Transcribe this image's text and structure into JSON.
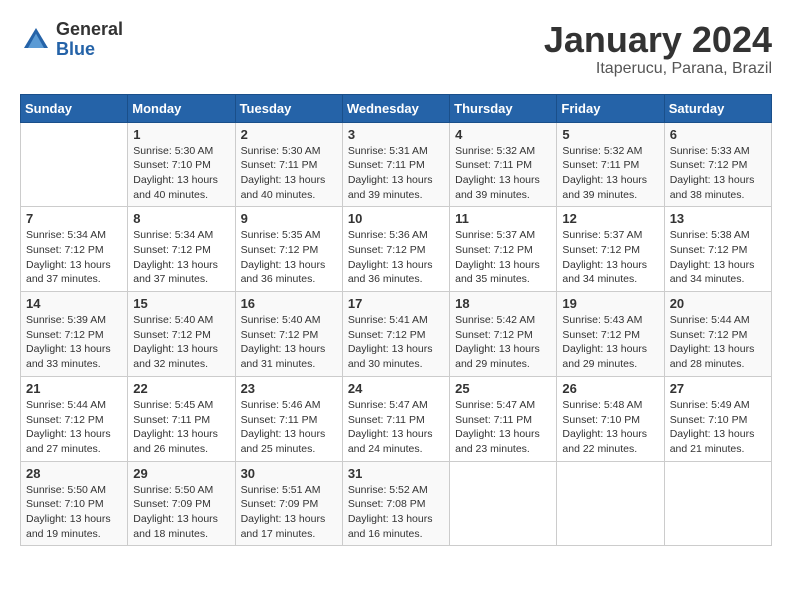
{
  "header": {
    "logo_general": "General",
    "logo_blue": "Blue",
    "month_title": "January 2024",
    "location": "Itaperucu, Parana, Brazil"
  },
  "days_of_week": [
    "Sunday",
    "Monday",
    "Tuesday",
    "Wednesday",
    "Thursday",
    "Friday",
    "Saturday"
  ],
  "weeks": [
    [
      {
        "day": "",
        "sunrise": "",
        "sunset": "",
        "daylight": ""
      },
      {
        "day": "1",
        "sunrise": "Sunrise: 5:30 AM",
        "sunset": "Sunset: 7:10 PM",
        "daylight": "Daylight: 13 hours and 40 minutes."
      },
      {
        "day": "2",
        "sunrise": "Sunrise: 5:30 AM",
        "sunset": "Sunset: 7:11 PM",
        "daylight": "Daylight: 13 hours and 40 minutes."
      },
      {
        "day": "3",
        "sunrise": "Sunrise: 5:31 AM",
        "sunset": "Sunset: 7:11 PM",
        "daylight": "Daylight: 13 hours and 39 minutes."
      },
      {
        "day": "4",
        "sunrise": "Sunrise: 5:32 AM",
        "sunset": "Sunset: 7:11 PM",
        "daylight": "Daylight: 13 hours and 39 minutes."
      },
      {
        "day": "5",
        "sunrise": "Sunrise: 5:32 AM",
        "sunset": "Sunset: 7:11 PM",
        "daylight": "Daylight: 13 hours and 39 minutes."
      },
      {
        "day": "6",
        "sunrise": "Sunrise: 5:33 AM",
        "sunset": "Sunset: 7:12 PM",
        "daylight": "Daylight: 13 hours and 38 minutes."
      }
    ],
    [
      {
        "day": "7",
        "sunrise": "Sunrise: 5:34 AM",
        "sunset": "Sunset: 7:12 PM",
        "daylight": "Daylight: 13 hours and 37 minutes."
      },
      {
        "day": "8",
        "sunrise": "Sunrise: 5:34 AM",
        "sunset": "Sunset: 7:12 PM",
        "daylight": "Daylight: 13 hours and 37 minutes."
      },
      {
        "day": "9",
        "sunrise": "Sunrise: 5:35 AM",
        "sunset": "Sunset: 7:12 PM",
        "daylight": "Daylight: 13 hours and 36 minutes."
      },
      {
        "day": "10",
        "sunrise": "Sunrise: 5:36 AM",
        "sunset": "Sunset: 7:12 PM",
        "daylight": "Daylight: 13 hours and 36 minutes."
      },
      {
        "day": "11",
        "sunrise": "Sunrise: 5:37 AM",
        "sunset": "Sunset: 7:12 PM",
        "daylight": "Daylight: 13 hours and 35 minutes."
      },
      {
        "day": "12",
        "sunrise": "Sunrise: 5:37 AM",
        "sunset": "Sunset: 7:12 PM",
        "daylight": "Daylight: 13 hours and 34 minutes."
      },
      {
        "day": "13",
        "sunrise": "Sunrise: 5:38 AM",
        "sunset": "Sunset: 7:12 PM",
        "daylight": "Daylight: 13 hours and 34 minutes."
      }
    ],
    [
      {
        "day": "14",
        "sunrise": "Sunrise: 5:39 AM",
        "sunset": "Sunset: 7:12 PM",
        "daylight": "Daylight: 13 hours and 33 minutes."
      },
      {
        "day": "15",
        "sunrise": "Sunrise: 5:40 AM",
        "sunset": "Sunset: 7:12 PM",
        "daylight": "Daylight: 13 hours and 32 minutes."
      },
      {
        "day": "16",
        "sunrise": "Sunrise: 5:40 AM",
        "sunset": "Sunset: 7:12 PM",
        "daylight": "Daylight: 13 hours and 31 minutes."
      },
      {
        "day": "17",
        "sunrise": "Sunrise: 5:41 AM",
        "sunset": "Sunset: 7:12 PM",
        "daylight": "Daylight: 13 hours and 30 minutes."
      },
      {
        "day": "18",
        "sunrise": "Sunrise: 5:42 AM",
        "sunset": "Sunset: 7:12 PM",
        "daylight": "Daylight: 13 hours and 29 minutes."
      },
      {
        "day": "19",
        "sunrise": "Sunrise: 5:43 AM",
        "sunset": "Sunset: 7:12 PM",
        "daylight": "Daylight: 13 hours and 29 minutes."
      },
      {
        "day": "20",
        "sunrise": "Sunrise: 5:44 AM",
        "sunset": "Sunset: 7:12 PM",
        "daylight": "Daylight: 13 hours and 28 minutes."
      }
    ],
    [
      {
        "day": "21",
        "sunrise": "Sunrise: 5:44 AM",
        "sunset": "Sunset: 7:12 PM",
        "daylight": "Daylight: 13 hours and 27 minutes."
      },
      {
        "day": "22",
        "sunrise": "Sunrise: 5:45 AM",
        "sunset": "Sunset: 7:11 PM",
        "daylight": "Daylight: 13 hours and 26 minutes."
      },
      {
        "day": "23",
        "sunrise": "Sunrise: 5:46 AM",
        "sunset": "Sunset: 7:11 PM",
        "daylight": "Daylight: 13 hours and 25 minutes."
      },
      {
        "day": "24",
        "sunrise": "Sunrise: 5:47 AM",
        "sunset": "Sunset: 7:11 PM",
        "daylight": "Daylight: 13 hours and 24 minutes."
      },
      {
        "day": "25",
        "sunrise": "Sunrise: 5:47 AM",
        "sunset": "Sunset: 7:11 PM",
        "daylight": "Daylight: 13 hours and 23 minutes."
      },
      {
        "day": "26",
        "sunrise": "Sunrise: 5:48 AM",
        "sunset": "Sunset: 7:10 PM",
        "daylight": "Daylight: 13 hours and 22 minutes."
      },
      {
        "day": "27",
        "sunrise": "Sunrise: 5:49 AM",
        "sunset": "Sunset: 7:10 PM",
        "daylight": "Daylight: 13 hours and 21 minutes."
      }
    ],
    [
      {
        "day": "28",
        "sunrise": "Sunrise: 5:50 AM",
        "sunset": "Sunset: 7:10 PM",
        "daylight": "Daylight: 13 hours and 19 minutes."
      },
      {
        "day": "29",
        "sunrise": "Sunrise: 5:50 AM",
        "sunset": "Sunset: 7:09 PM",
        "daylight": "Daylight: 13 hours and 18 minutes."
      },
      {
        "day": "30",
        "sunrise": "Sunrise: 5:51 AM",
        "sunset": "Sunset: 7:09 PM",
        "daylight": "Daylight: 13 hours and 17 minutes."
      },
      {
        "day": "31",
        "sunrise": "Sunrise: 5:52 AM",
        "sunset": "Sunset: 7:08 PM",
        "daylight": "Daylight: 13 hours and 16 minutes."
      },
      {
        "day": "",
        "sunrise": "",
        "sunset": "",
        "daylight": ""
      },
      {
        "day": "",
        "sunrise": "",
        "sunset": "",
        "daylight": ""
      },
      {
        "day": "",
        "sunrise": "",
        "sunset": "",
        "daylight": ""
      }
    ]
  ]
}
